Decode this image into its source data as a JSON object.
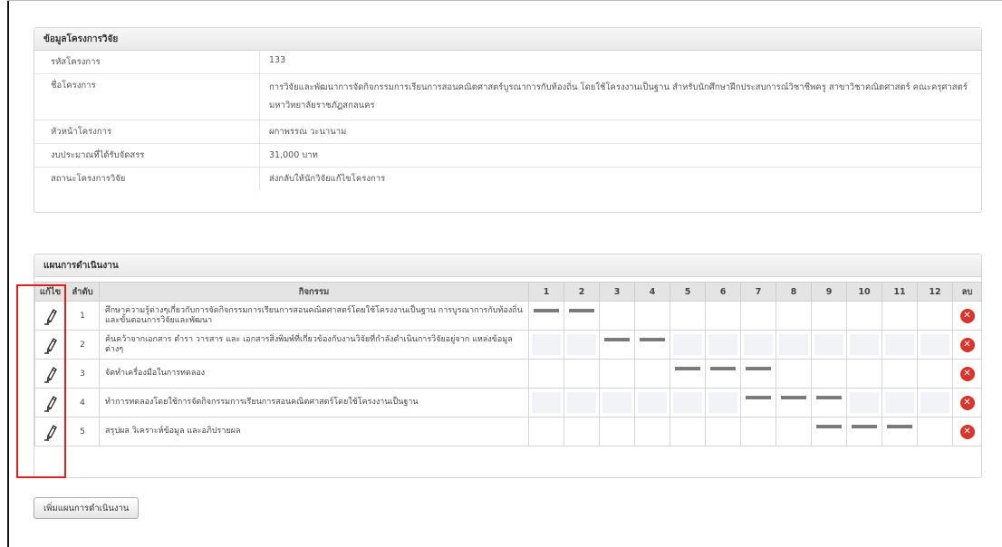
{
  "project_info": {
    "title": "ข้อมูลโครงการวิจัย",
    "rows": [
      {
        "label": "รหัสโครงการ",
        "value": "133"
      },
      {
        "label": "ชื่อโครงการ",
        "value": "การวิจัยและพัฒนาการจัดกิจกรรมการเรียนการสอนคณิตศาสตร์บูรณาการกับท้องถิ่น โดยใช้โครงงานเป็นฐาน สำหรับนักศึกษาฝึกประสบการณ์วิชาชีพครู สาขาวิชาคณิตศาสตร์ คณะครุศาสตร์ มหาวิทยาลัยราชภัฏสกลนคร"
      },
      {
        "label": "หัวหน้าโครงการ",
        "value": "ผกาพรรณ วะนานาม"
      },
      {
        "label": "งบประมาณที่ได้รับจัดสรร",
        "value": "31,000 บาท"
      },
      {
        "label": "สถานะโครงการวิจัย",
        "value": "ส่งกลับให้นักวิจัยแก้ไขโครงการ"
      }
    ]
  },
  "plan": {
    "title": "แผนการดำเนินงาน",
    "headers": {
      "edit": "แก้ไข",
      "seq": "ลำดับ",
      "activity": "กิจกรรม",
      "months": [
        "1",
        "2",
        "3",
        "4",
        "5",
        "6",
        "7",
        "8",
        "9",
        "10",
        "11",
        "12"
      ],
      "delete": "ลบ"
    },
    "rows": [
      {
        "seq": "1",
        "activity": "ศึกษาความรู้ต่างๆเกี่ยวกับการจัดกิจกรรมการเรียนการสอนคณิตศาสตร์โดยใช้โครงงานเป็นฐาน การบูรณาการกับท้องถิ่น และขั้นตอนการวิจัยและพัฒนา",
        "active_months": [
          1,
          2
        ]
      },
      {
        "seq": "2",
        "activity": "ค้นคว้าจากเอกสาร ตำรา วารสาร และ เอกสารสิ่งพิมพ์ที่เกี่ยวข้องกับงานวิจัยที่กำลังดำเนินการวิจัยอยู่จาก แหล่งข้อมูลต่างๆ",
        "active_months": [
          3,
          4
        ]
      },
      {
        "seq": "3",
        "activity": "จัดทำเครื่องมือในการทดลอง",
        "active_months": [
          5,
          6,
          7
        ]
      },
      {
        "seq": "4",
        "activity": "ทำการทดลองโดยใช้การจัดกิจกรรมการเรียนการสอนคณิตศาสตร์โดยใช้โครงงานเป็นฐาน",
        "active_months": [
          7,
          8,
          9
        ]
      },
      {
        "seq": "5",
        "activity": "สรุปผล วิเคราะห์ข้อมูล และอภิปรายผล",
        "active_months": [
          9,
          10,
          11
        ]
      }
    ],
    "add_button_label": "เพิ่มแผนการดำเนินงาน"
  },
  "icons": {
    "edit": "pencil-icon",
    "delete": "delete-x-icon"
  },
  "colors": {
    "highlight": "#e02020",
    "delete": "#d9352d",
    "bar": "#7a7a7a"
  }
}
